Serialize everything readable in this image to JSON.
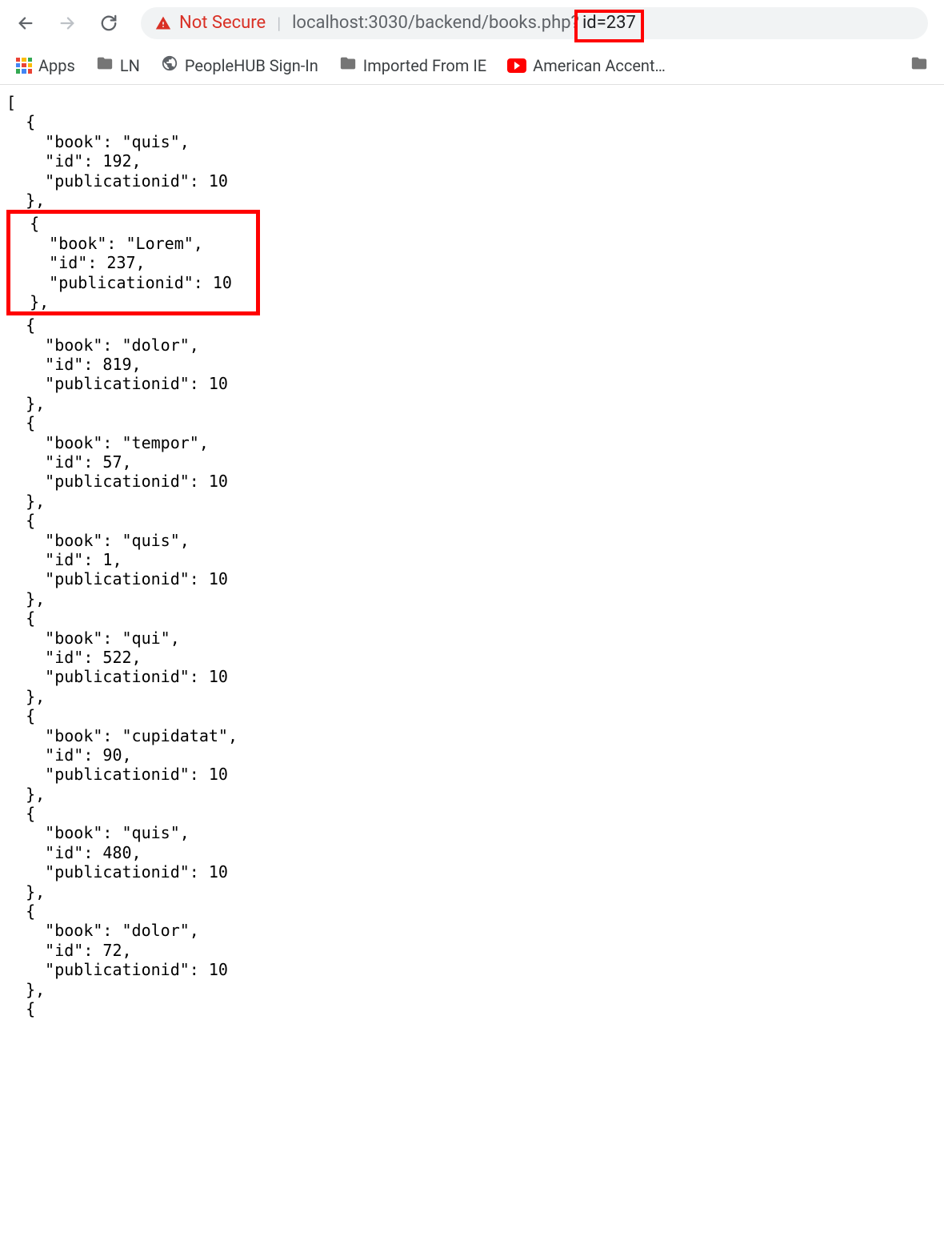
{
  "toolbar": {
    "not_secure": "Not Secure",
    "url_host": "localhost",
    "url_port_path": ":3030/backend/books.php?",
    "url_query": "id=237"
  },
  "bookmarks": {
    "apps": "Apps",
    "items": [
      {
        "label": "LN",
        "type": "folder"
      },
      {
        "label": "PeopleHUB Sign-In",
        "type": "globe"
      },
      {
        "label": "Imported From IE",
        "type": "folder"
      },
      {
        "label": "American Accent…",
        "type": "youtube"
      }
    ]
  },
  "json_output": {
    "books": [
      {
        "book": "quis",
        "id": 192,
        "publicationid": 10,
        "highlighted": false
      },
      {
        "book": "Lorem",
        "id": 237,
        "publicationid": 10,
        "highlighted": true
      },
      {
        "book": "dolor",
        "id": 819,
        "publicationid": 10,
        "highlighted": false
      },
      {
        "book": "tempor",
        "id": 57,
        "publicationid": 10,
        "highlighted": false
      },
      {
        "book": "quis",
        "id": 1,
        "publicationid": 10,
        "highlighted": false
      },
      {
        "book": "qui",
        "id": 522,
        "publicationid": 10,
        "highlighted": false
      },
      {
        "book": "cupidatat",
        "id": 90,
        "publicationid": 10,
        "highlighted": false
      },
      {
        "book": "quis",
        "id": 480,
        "publicationid": 10,
        "highlighted": false
      },
      {
        "book": "dolor",
        "id": 72,
        "publicationid": 10,
        "highlighted": false
      }
    ]
  }
}
